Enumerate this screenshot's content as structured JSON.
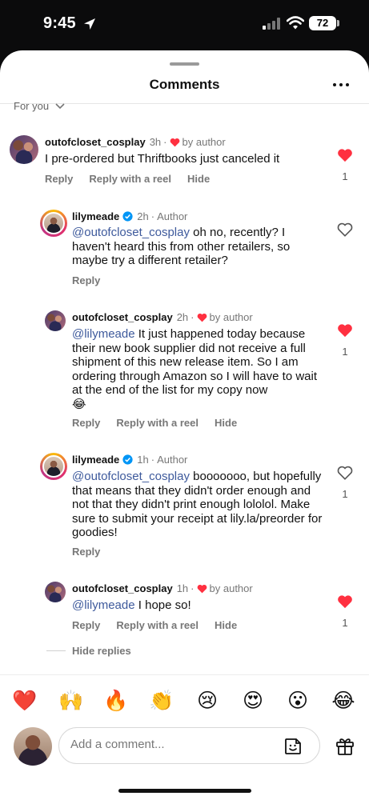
{
  "status_bar": {
    "time": "9:45",
    "battery": "72"
  },
  "header": {
    "title": "Comments",
    "filter_label": "For you"
  },
  "comments": [
    {
      "username": "outofcloset_cosplay",
      "time": "3h",
      "liked_by_author_label": "by author",
      "text": "I pre-ordered but Thriftbooks just canceled it",
      "actions": [
        "Reply",
        "Reply with a reel",
        "Hide"
      ],
      "likes": "1",
      "liked": true
    },
    {
      "username": "lilymeade",
      "time": "2h",
      "author_label": "Author",
      "mention": "@outofcloset_cosplay",
      "text": " oh no, recently? I haven't heard this from other retailers, so maybe try a different retailer?",
      "actions": [
        "Reply"
      ],
      "liked": false
    },
    {
      "username": "outofcloset_cosplay",
      "time": "2h",
      "liked_by_author_label": "by author",
      "mention": "@lilymeade",
      "text": " It just happened today because their new book supplier did not receive a full shipment of this new release item.  So I am ordering through Amazon so I will have to wait at the end of the list for my copy now",
      "emoji": "😂",
      "actions": [
        "Reply",
        "Reply with a reel",
        "Hide"
      ],
      "likes": "1",
      "liked": true
    },
    {
      "username": "lilymeade",
      "time": "1h",
      "author_label": "Author",
      "mention": "@outofcloset_cosplay",
      "text": " booooooo, but hopefully that means that they didn't order enough and not that they didn't print enough lololol. Make sure to submit your receipt at lily.la/preorder for goodies!",
      "actions": [
        "Reply"
      ],
      "likes": "1",
      "liked": false
    },
    {
      "username": "outofcloset_cosplay",
      "time": "1h",
      "liked_by_author_label": "by author",
      "mention": "@lilymeade",
      "text": " I hope so!",
      "actions": [
        "Reply",
        "Reply with a reel",
        "Hide"
      ],
      "likes": "1",
      "liked": true
    }
  ],
  "hide_replies_label": "Hide replies",
  "quick_reactions": [
    "❤️",
    "🙌",
    "🔥",
    "👏",
    "😢",
    "😍",
    "😮",
    "😂"
  ],
  "composer": {
    "placeholder": "Add a comment..."
  },
  "colors": {
    "like_red": "#ff3040",
    "mention_blue": "#3e5a9c",
    "verified_blue": "#0095f6"
  },
  "icons": [
    "location-arrow-icon",
    "signal-icon",
    "wifi-icon",
    "battery-icon",
    "more-icon",
    "chevron-down-icon",
    "heart-icon",
    "verified-icon",
    "sticker-icon",
    "gift-icon"
  ]
}
